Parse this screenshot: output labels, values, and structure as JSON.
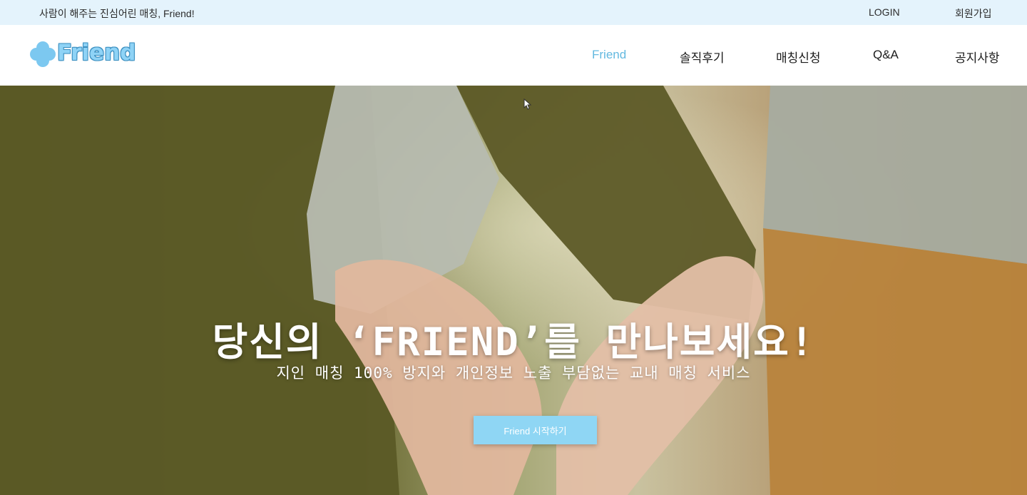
{
  "topbar": {
    "tagline": "사람이 해주는 진심어린 매칭, Friend!",
    "login": "LOGIN",
    "signup": "회원가입"
  },
  "logo": {
    "text": "Friend",
    "icon": "clover-icon"
  },
  "nav": {
    "items": [
      {
        "label": "Friend",
        "active": true
      },
      {
        "label": "솔직후기",
        "active": false
      },
      {
        "label": "매칭신청",
        "active": false
      },
      {
        "label": "Q&A",
        "active": false
      },
      {
        "label": "공지사항",
        "active": false
      }
    ]
  },
  "hero": {
    "title": "당신의 ‘FRIEND’를 만나보세요!",
    "subtitle": "지인 매칭 100% 방지와 개인정보 노출 부담없는 교내 매칭 서비스",
    "cta_label": "Friend 시작하기"
  },
  "colors": {
    "topbar_bg": "#e4f3fc",
    "accent": "#63b9e0",
    "cta_bg": "#8fd6f4"
  }
}
